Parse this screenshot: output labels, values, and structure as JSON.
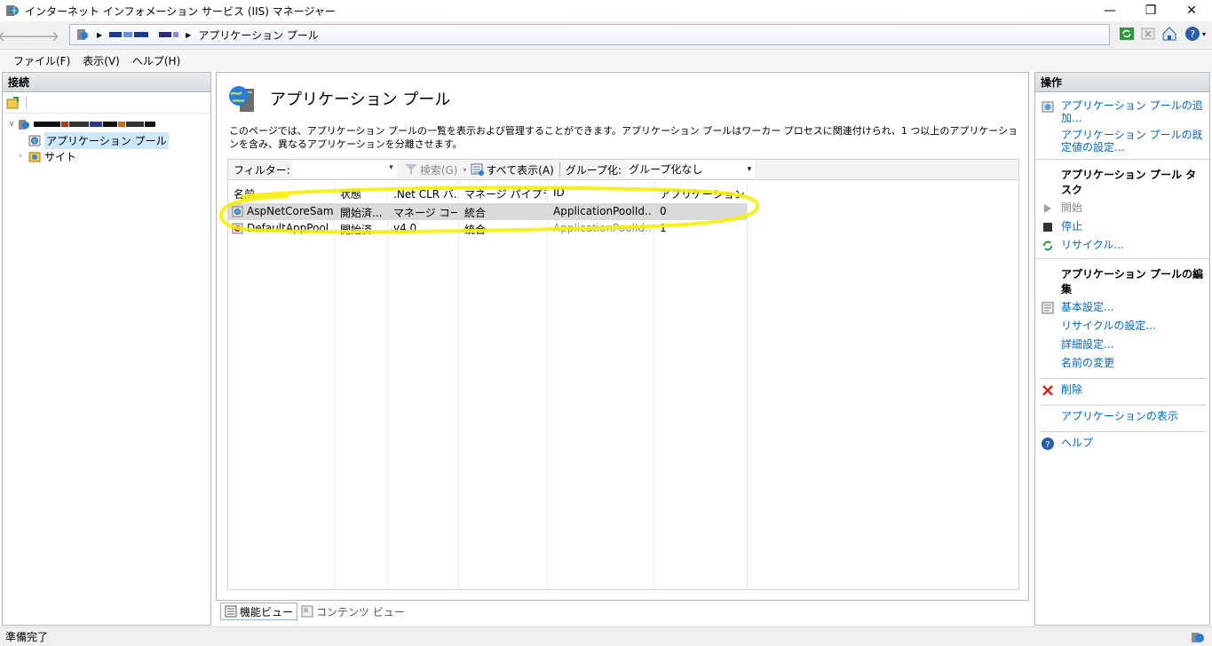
{
  "window": {
    "title": "インターネット インフォメーション サービス (IIS) マネージャー",
    "minimize": "—",
    "maximize": "❐",
    "close": "✕"
  },
  "address": {
    "crumb_last": "アプリケーション プール"
  },
  "menu": [
    "ファイル(F)",
    "表示(V)",
    "ヘルプ(H)"
  ],
  "connections": {
    "header": "接続",
    "tree": [
      {
        "label": "アプリケーション プール"
      },
      {
        "label": "サイト"
      }
    ]
  },
  "main": {
    "title": "アプリケーション プール",
    "description": "このページでは、アプリケーション プールの一覧を表示および管理することができます。アプリケーション プールはワーカー プロセスに関連付けられ、1 つ以上のアプリケーションを含み、異なるアプリケーションを分離させます。",
    "filter_label": "フィルター:",
    "search_label": "検索(G)",
    "show_all_label": "すべて表示(A)",
    "group_label": "グループ化:",
    "group_value": "グループ化なし",
    "columns": [
      "名前",
      "状態",
      ".Net CLR バ...",
      "マネージ パイプラ...",
      "ID",
      "アプリケーション"
    ],
    "rows": [
      {
        "name": "AspNetCoreSam...",
        "status": "開始済...",
        "clr": "マネージ コー...",
        "pipeline": "統合",
        "identity": "ApplicationPoolId...",
        "apps": "0"
      },
      {
        "name": "DefaultAppPool",
        "status": "開始済...",
        "clr": "v4.0",
        "pipeline": "統合",
        "identity": "ApplicationPoolId...",
        "apps": "1"
      }
    ]
  },
  "view_tabs": {
    "features": "機能ビュー",
    "content": "コンテンツ ビュー"
  },
  "actions": {
    "header": "操作",
    "add_pool": "アプリケーション プールの追加...",
    "set_defaults": "アプリケーション プールの既定値の設定...",
    "tasks_group": "アプリケーション プール タスク",
    "start": "開始",
    "stop": "停止",
    "recycle": "リサイクル...",
    "edit_group": "アプリケーション プールの編集",
    "basic_settings": "基本設定...",
    "recycle_settings": "リサイクルの設定...",
    "advanced_settings": "詳細設定...",
    "rename": "名前の変更",
    "delete": "削除",
    "view_apps": "アプリケーションの表示",
    "help": "ヘルプ"
  },
  "status": {
    "text": "準備完了"
  },
  "colors": {
    "selection": "#cce8ff",
    "row_selected": "#d9d9d9",
    "link": "#0066cc",
    "highlight_marker": "#f5f000"
  }
}
